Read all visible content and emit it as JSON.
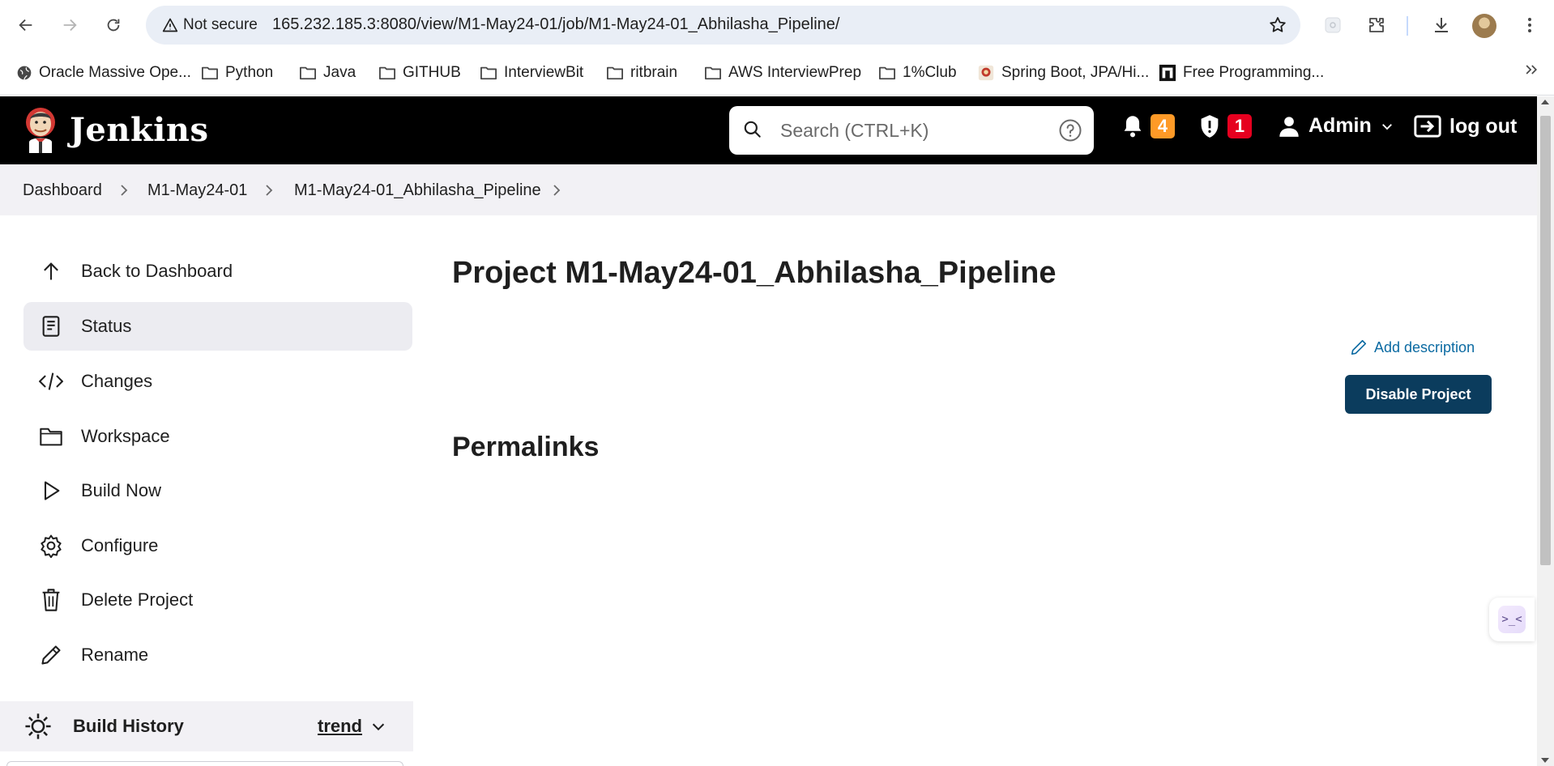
{
  "browser": {
    "security_label": "Not secure",
    "url": "165.232.185.3:8080/view/M1-May24-01/job/M1-May24-01_Abhilasha_Pipeline/",
    "bookmarks": [
      {
        "label": "Oracle Massive Ope...",
        "icon": "globe-icon"
      },
      {
        "label": "Python",
        "icon": "folder-icon"
      },
      {
        "label": "Java",
        "icon": "folder-icon"
      },
      {
        "label": "GITHUB",
        "icon": "folder-icon"
      },
      {
        "label": "InterviewBit",
        "icon": "folder-icon"
      },
      {
        "label": "ritbrain",
        "icon": "folder-icon"
      },
      {
        "label": "AWS InterviewPrep",
        "icon": "folder-icon"
      },
      {
        "label": "1%Club",
        "icon": "folder-icon"
      },
      {
        "label": "Spring Boot, JPA/Hi...",
        "icon": "site-favicon"
      },
      {
        "label": "Free Programming...",
        "icon": "site-favicon"
      }
    ]
  },
  "header": {
    "app_name": "Jenkins",
    "search_placeholder": "Search (CTRL+K)",
    "notifications_count": "4",
    "security_count": "1",
    "user": "Admin",
    "logout": "log out",
    "colors": {
      "header_bg": "#000000",
      "notif_badge": "#fe9a27",
      "security_badge": "#e6001f"
    }
  },
  "breadcrumb": [
    "Dashboard",
    "M1-May24-01",
    "M1-May24-01_Abhilasha_Pipeline"
  ],
  "sidebar": {
    "items": [
      {
        "label": "Back to Dashboard",
        "icon": "arrow-up-icon"
      },
      {
        "label": "Status",
        "icon": "document-icon",
        "active": true
      },
      {
        "label": "Changes",
        "icon": "code-icon"
      },
      {
        "label": "Workspace",
        "icon": "folder-icon"
      },
      {
        "label": "Build Now",
        "icon": "play-icon"
      },
      {
        "label": "Configure",
        "icon": "gear-icon"
      },
      {
        "label": "Delete Project",
        "icon": "trash-icon"
      },
      {
        "label": "Rename",
        "icon": "pencil-icon"
      }
    ],
    "build_history": {
      "title": "Build History",
      "trend": "trend"
    }
  },
  "main": {
    "title": "Project M1-May24-01_Abhilasha_Pipeline",
    "add_description": "Add description",
    "disable_button": "Disable Project",
    "permalinks": "Permalinks",
    "colors": {
      "link": "#0b6aa2",
      "primary_button": "#0b3c5d"
    }
  }
}
